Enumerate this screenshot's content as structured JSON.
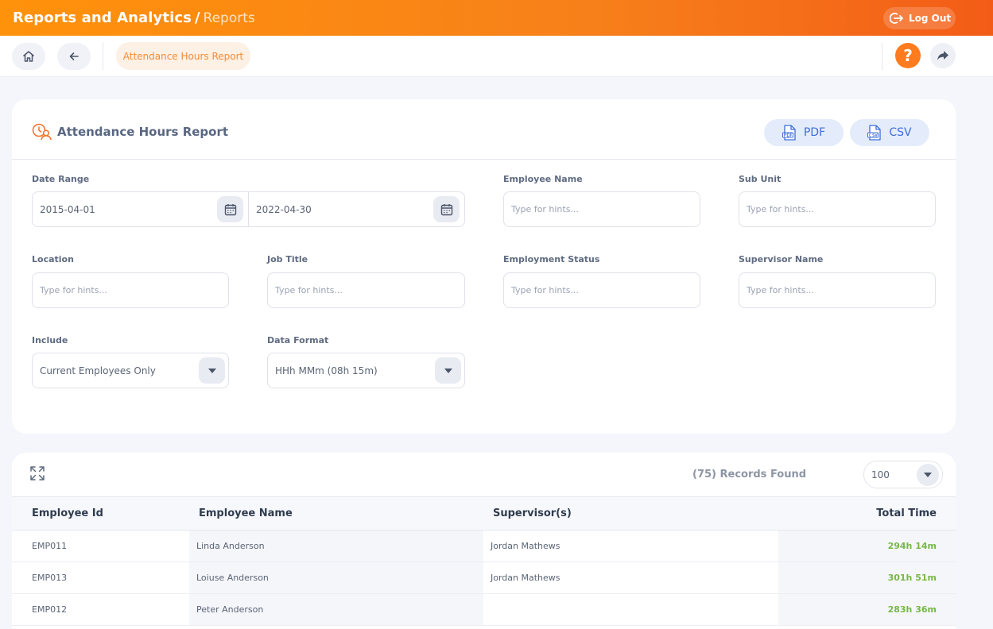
{
  "header": {
    "module": "Reports and Analytics",
    "separator": "/",
    "page": "Reports",
    "logout_label": "Log Out"
  },
  "subnav": {
    "active_tab": "Attendance Hours Report",
    "help_label": "?"
  },
  "filter": {
    "title": "Attendance Hours Report",
    "pdf_label": "PDF",
    "csv_label": "CSV",
    "date_range": {
      "label": "Date Range",
      "from": "2015-04-01",
      "to": "2022-04-30"
    },
    "employee_name": {
      "label": "Employee Name",
      "placeholder": "Type for hints..."
    },
    "sub_unit": {
      "label": "Sub Unit",
      "placeholder": "Type for hints..."
    },
    "location": {
      "label": "Location",
      "placeholder": "Type for hints..."
    },
    "job_title": {
      "label": "Job Title",
      "placeholder": "Type for hints..."
    },
    "employment_status": {
      "label": "Employment Status",
      "placeholder": "Type for hints..."
    },
    "supervisor_name": {
      "label": "Supervisor Name",
      "placeholder": "Type for hints..."
    },
    "include": {
      "label": "Include",
      "value": "Current Employees Only"
    },
    "data_format": {
      "label": "Data Format",
      "value": "HHh MMm (08h 15m)"
    }
  },
  "table": {
    "records_text": "(75) Records Found",
    "per_page": "100",
    "columns": [
      "Employee Id",
      "Employee Name",
      "Supervisor(s)",
      "Total Time"
    ],
    "rows": [
      {
        "id": "EMP011",
        "name": "Linda Anderson",
        "supervisor": "Jordan Mathews",
        "total": "294h 14m"
      },
      {
        "id": "EMP013",
        "name": "Loiuse Anderson",
        "supervisor": "Jordan Mathews",
        "total": "301h 51m"
      },
      {
        "id": "EMP012",
        "name": "Peter Anderson",
        "supervisor": "",
        "total": "283h 36m"
      }
    ]
  },
  "colors": {
    "brand_orange": "#ff920b",
    "accent_blue": "#3f6ed8",
    "total_green": "#76b845"
  }
}
